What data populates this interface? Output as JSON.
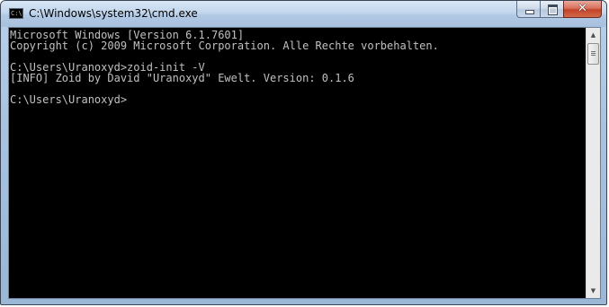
{
  "window": {
    "title": "C:\\Windows\\system32\\cmd.exe",
    "app_icon": "cmd-icon",
    "app_icon_text": "C:\\"
  },
  "caption_buttons": {
    "minimize_icon": "minimize-icon",
    "maximize_icon": "maximize-icon",
    "close_icon": "close-icon",
    "close_glyph": "✕"
  },
  "console": {
    "lines": [
      "Microsoft Windows [Version 6.1.7601]",
      "Copyright (c) 2009 Microsoft Corporation. Alle Rechte vorbehalten.",
      "",
      "C:\\Users\\Uranoxyd>zoid-init -V",
      "[INFO] Zoid by David \"Uranoxyd\" Ewelt. Version: 0.1.6",
      "",
      "C:\\Users\\Uranoxyd>"
    ]
  },
  "scrollbar": {
    "up_arrow": "▲",
    "down_arrow": "▼"
  },
  "colors": {
    "console_bg": "#000000",
    "console_fg": "#c0c0c0",
    "close_button": "#c2432a"
  }
}
